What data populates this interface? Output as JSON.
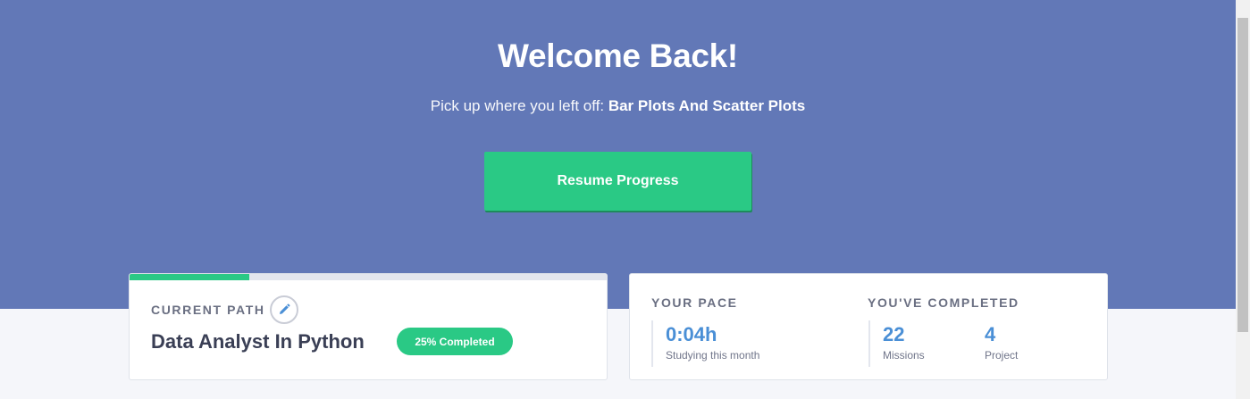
{
  "hero": {
    "title": "Welcome Back!",
    "subtitle_lead": "Pick up where you left off: ",
    "subtitle_lesson": "Bar Plots And Scatter Plots",
    "resume_label": "Resume Progress"
  },
  "current_path": {
    "label": "CURRENT PATH",
    "name": "Data Analyst In Python",
    "badge": "25% Completed",
    "progress": 0.25,
    "edit_icon": "pencil-icon"
  },
  "pace": {
    "label": "YOUR PACE",
    "value": "0:04h",
    "caption": "Studying this month"
  },
  "completed": {
    "label": "YOU'VE COMPLETED",
    "missions_value": "22",
    "missions_caption": "Missions",
    "projects_value": "4",
    "projects_caption": "Project"
  },
  "colors": {
    "hero_bg": "#6278b7",
    "accent_green": "#2ac985",
    "stat_blue": "#4a8fd6",
    "page_bg": "#f5f6fa"
  }
}
